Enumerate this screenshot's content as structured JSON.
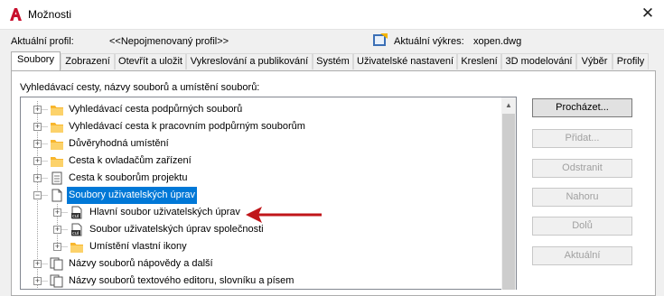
{
  "window": {
    "title": "Možnosti",
    "close_glyph": "✕"
  },
  "profile": {
    "label": "Aktuální profil:",
    "value": "<<Nepojmenovaný profil>>"
  },
  "drawing": {
    "label": "Aktuální výkres:",
    "value": "xopen.dwg"
  },
  "tabs": [
    {
      "label": "Soubory"
    },
    {
      "label": "Zobrazení"
    },
    {
      "label": "Otevřít a uložit"
    },
    {
      "label": "Vykreslování a publikování"
    },
    {
      "label": "Systém"
    },
    {
      "label": "Uživatelské nastavení"
    },
    {
      "label": "Kreslení"
    },
    {
      "label": "3D modelování"
    },
    {
      "label": "Výběr"
    },
    {
      "label": "Profily"
    }
  ],
  "active_tab": "Soubory",
  "panel_label": "Vyhledávací cesty, názvy souborů a umístění souborů:",
  "tree": [
    {
      "label": "Vyhledávací cesta podpůrných souborů",
      "icon": "folder-icon"
    },
    {
      "label": "Vyhledávací cesta k pracovním podpůrným souborům",
      "icon": "folder-icon"
    },
    {
      "label": "Důvěryhodná umístění",
      "icon": "folder-icon"
    },
    {
      "label": "Cesta k ovladačům zařízení",
      "icon": "folder-icon"
    },
    {
      "label": "Cesta k souborům projektu",
      "icon": "document-icon"
    },
    {
      "label": "Soubory uživatelských úprav",
      "icon": "document-icon",
      "selected": true
    },
    {
      "label": "Hlavní soubor uživatelských úprav",
      "icon": "cui-file-icon"
    },
    {
      "label": "Soubor uživatelských úprav společnosti",
      "icon": "cui-file-icon"
    },
    {
      "label": "Umístění vlastní ikony",
      "icon": "folder-icon"
    },
    {
      "label": "Názvy souborů nápovědy a další",
      "icon": "documents-icon"
    },
    {
      "label": "Názvy souborů textového editoru, slovníku a písem",
      "icon": "documents-icon"
    }
  ],
  "buttons": {
    "browse": "Procházet...",
    "add": "Přidat...",
    "remove": "Odstranit",
    "up": "Nahoru",
    "down": "Dolů",
    "current": "Aktuální"
  },
  "colors": {
    "selection": "#0078d7",
    "arrow": "#c0161a",
    "folder": "#f8b62d",
    "app_red": "#c8102e"
  }
}
